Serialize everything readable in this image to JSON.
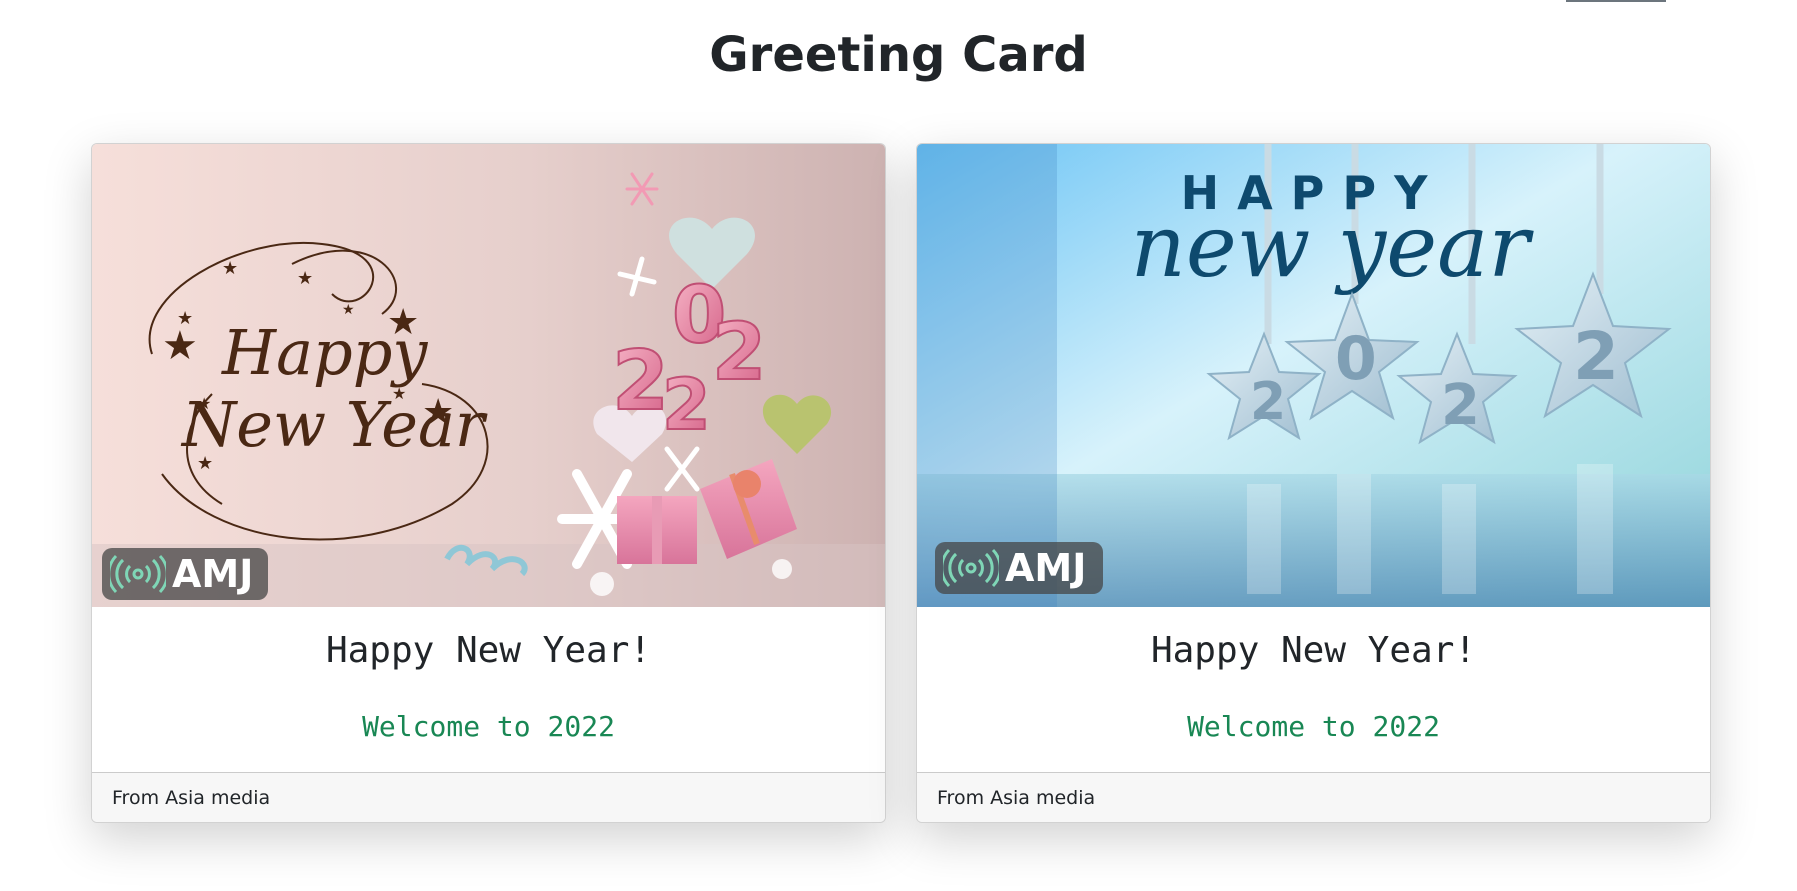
{
  "page": {
    "title": "Greeting Card"
  },
  "cards": [
    {
      "heading": "Happy New Year!",
      "subheading": "Welcome to 2022",
      "footer": "From Asia media",
      "image": {
        "script_line1": "Happy",
        "script_line2": "New Year",
        "numbers": [
          "2",
          "0",
          "2",
          "2"
        ],
        "logo": "AMJ"
      }
    },
    {
      "heading": "Happy New Year!",
      "subheading": "Welcome to 2022",
      "footer": "From Asia media",
      "image": {
        "line1": "HAPPY",
        "line2": "new year",
        "numbers": [
          "2",
          "0",
          "2",
          "2"
        ],
        "logo": "AMJ"
      }
    }
  ],
  "colors": {
    "subheading": "#198754",
    "script_brown": "#4a2814",
    "navy": "#0e4a6e"
  }
}
